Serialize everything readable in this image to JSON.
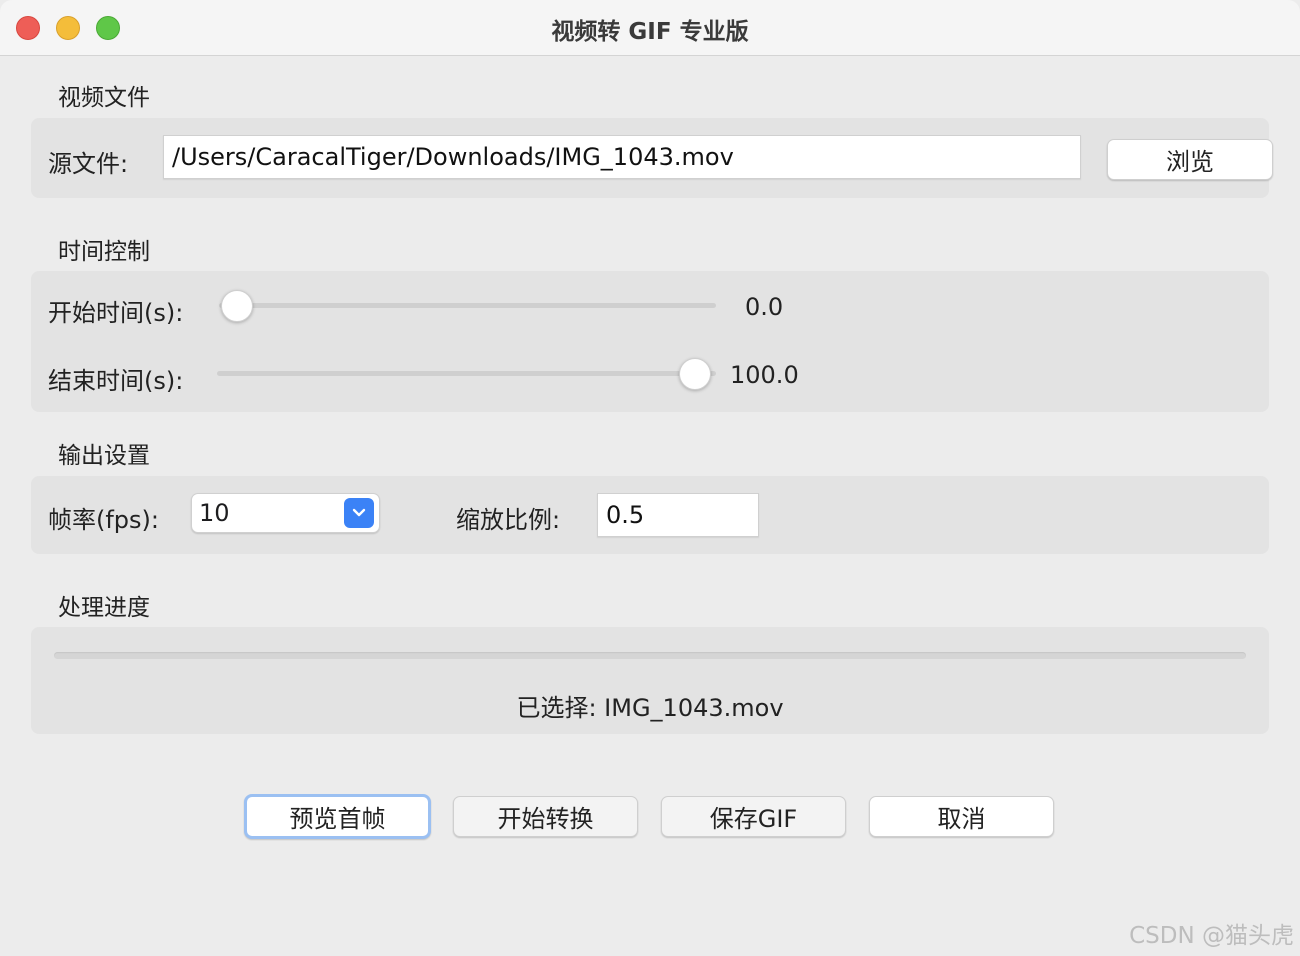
{
  "window": {
    "title": "视频转 GIF 专业版"
  },
  "video_file": {
    "section_label": "视频文件",
    "source_label": "源文件:",
    "source_value": "/Users/CaracalTiger/Downloads/IMG_1043.mov",
    "browse_label": "浏览"
  },
  "time_control": {
    "section_label": "时间控制",
    "start_label": "开始时间(s):",
    "start_value": "0.0",
    "start_fraction": 0.0,
    "end_label": "结束时间(s):",
    "end_value": "100.0",
    "end_fraction": 1.0
  },
  "output": {
    "section_label": "输出设置",
    "fps_label": "帧率(fps):",
    "fps_value": "10",
    "scale_label": "缩放比例:",
    "scale_value": "0.5"
  },
  "progress": {
    "section_label": "处理进度",
    "fraction": 0.0,
    "status": "已选择: IMG_1043.mov"
  },
  "actions": {
    "preview_label": "预览首帧",
    "convert_label": "开始转换",
    "save_label": "保存GIF",
    "cancel_label": "取消"
  },
  "watermark": "CSDN @猫头虎",
  "colors": {
    "accent": "#3b82f6",
    "close": "#ee5e57",
    "minimize": "#f4bd3a",
    "maximize": "#5fc748"
  }
}
